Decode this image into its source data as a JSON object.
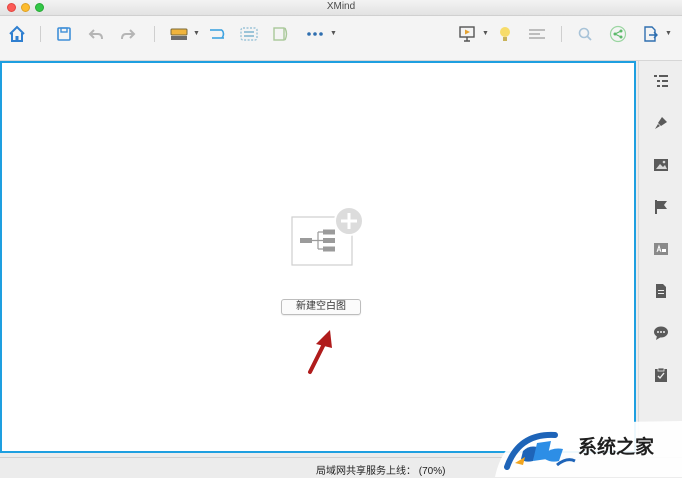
{
  "window": {
    "title": "XMind"
  },
  "toolbar": {
    "items": [
      {
        "icon": "home-icon"
      },
      {
        "icon": "save-icon"
      },
      {
        "icon": "undo-icon"
      },
      {
        "icon": "redo-icon"
      },
      {
        "icon": "structure-icon"
      },
      {
        "icon": "relationship-icon"
      },
      {
        "icon": "boundary-icon"
      },
      {
        "icon": "summary-icon"
      },
      {
        "icon": "more-icon"
      },
      {
        "icon": "presentation-icon"
      },
      {
        "icon": "brainstorm-icon"
      },
      {
        "icon": "outliner-icon"
      },
      {
        "icon": "search-icon"
      },
      {
        "icon": "share-icon"
      },
      {
        "icon": "export-icon"
      }
    ]
  },
  "canvas": {
    "new_blank_map_label": "新建空白图"
  },
  "sidebar": {
    "items": [
      {
        "icon": "outline-icon"
      },
      {
        "icon": "format-brush-icon"
      },
      {
        "icon": "image-icon"
      },
      {
        "icon": "marker-flag-icon"
      },
      {
        "icon": "text-style-icon"
      },
      {
        "icon": "notes-icon"
      },
      {
        "icon": "comments-icon"
      },
      {
        "icon": "task-icon"
      }
    ]
  },
  "statusbar": {
    "text": "局域网共享服务上线： (70%)"
  },
  "watermark": {
    "text": "系统之家"
  },
  "colors": {
    "accent": "#1e9fe0",
    "arrow": "#b01c1c"
  }
}
